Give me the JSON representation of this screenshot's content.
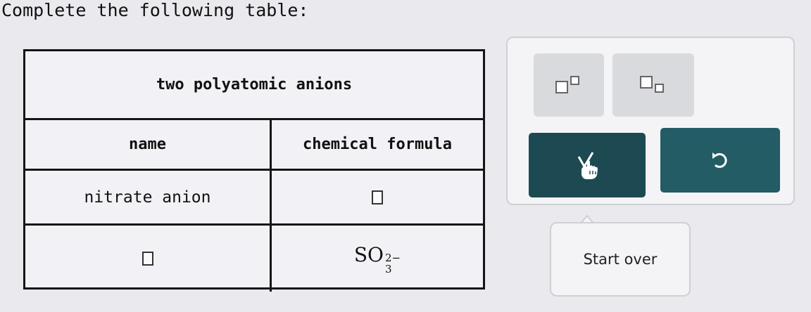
{
  "prompt": "Complete the following table:",
  "table": {
    "title": "two polyatomic anions",
    "headers": [
      "name",
      "chemical formula"
    ],
    "rows": [
      {
        "name": "nitrate anion",
        "formula": null
      },
      {
        "name": null,
        "formula": {
          "base": "SO",
          "subscript": "3",
          "superscript": "2−"
        }
      }
    ]
  },
  "tools": {
    "superscript_icon": "superscript-box-icon",
    "subscript_icon": "subscript-box-icon",
    "check_icon": "check-hand-icon",
    "undo_icon": "undo-icon"
  },
  "start_over_label": "Start over",
  "colors": {
    "check_button": "#1d4a52",
    "undo_button": "#235c65",
    "panel_border": "#cfd0d6"
  }
}
